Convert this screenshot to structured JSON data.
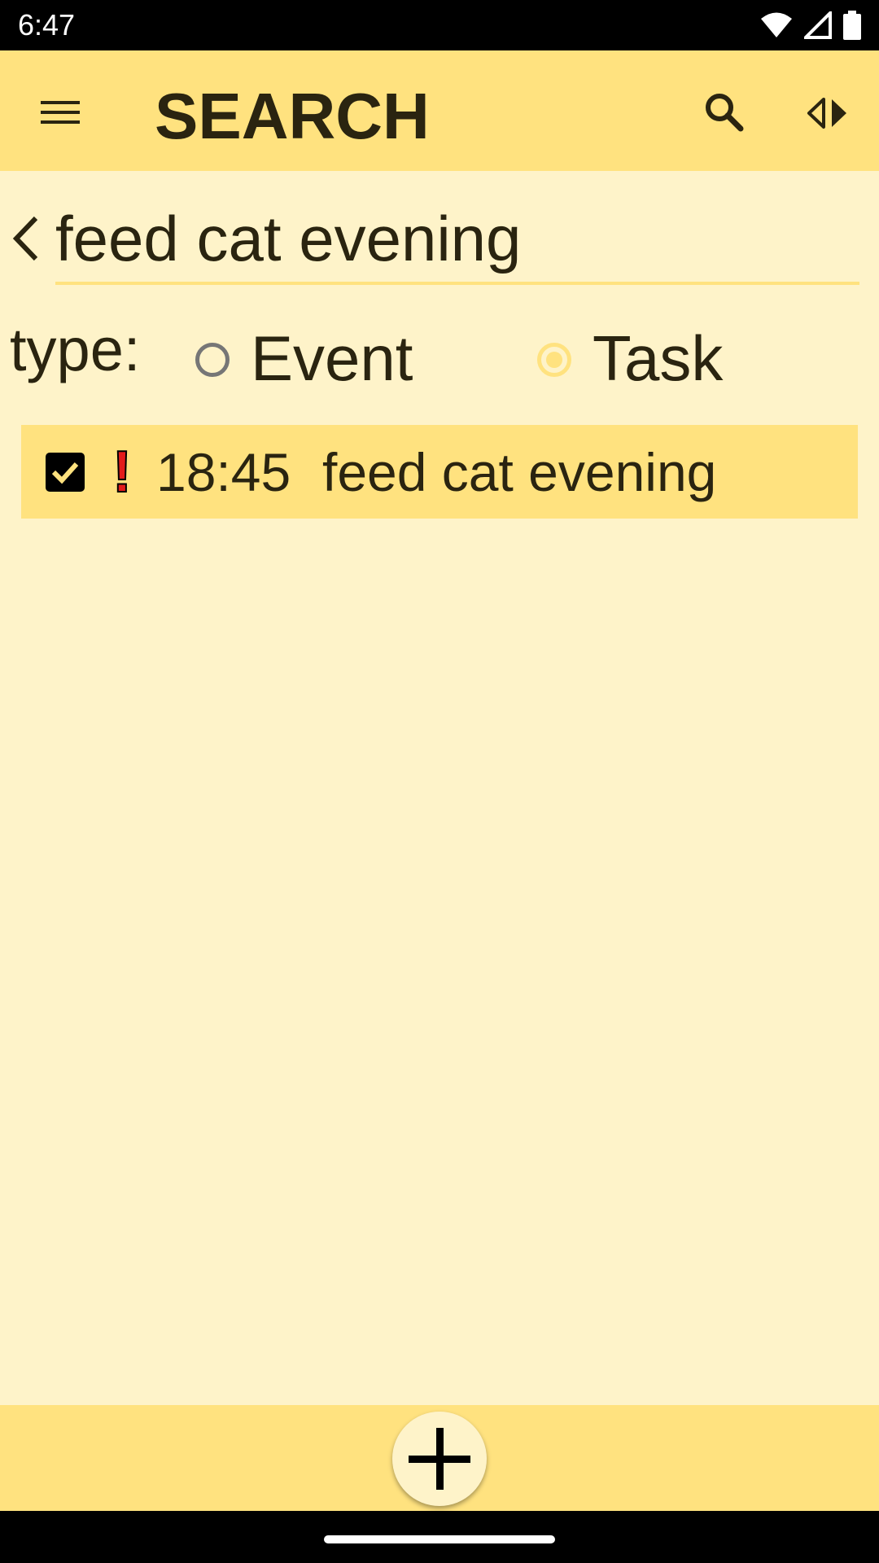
{
  "status_bar": {
    "time": "6:47"
  },
  "app_bar": {
    "title": "SEARCH",
    "color": "#ffe27f"
  },
  "search": {
    "query": "feed cat evening"
  },
  "type_filter": {
    "label": "type:",
    "options": [
      {
        "label": "Event",
        "selected": false
      },
      {
        "label": "Task",
        "selected": true
      }
    ]
  },
  "results": [
    {
      "checked": true,
      "priority": "!",
      "time": "18:45",
      "title": "feed cat evening"
    }
  ],
  "colors": {
    "background": "#fef3c9",
    "accent": "#ffe27f",
    "priority": "#e31b1b"
  }
}
